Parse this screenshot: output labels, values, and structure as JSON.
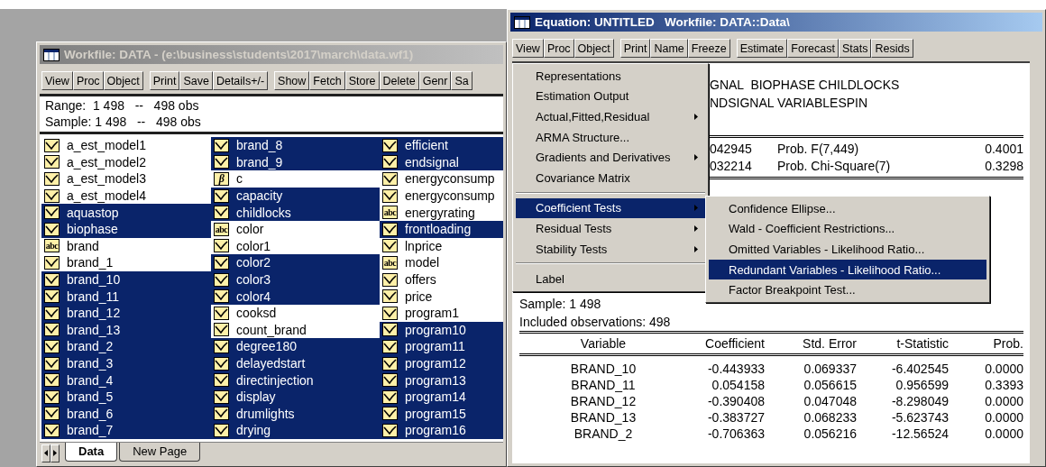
{
  "workfile": {
    "title": "Workfile: DATA - (e:\\business\\students\\2017\\march\\data.wf1)",
    "active": false,
    "toolbar": [
      [
        "View",
        "Proc",
        "Object"
      ],
      [
        "Print",
        "Save",
        "Details+/-"
      ],
      [
        "Show",
        "Fetch",
        "Store",
        "Delete",
        "Genr",
        "Sa"
      ]
    ],
    "range": "Range:  1 498   --   498 obs",
    "sample": "Sample: 1 498   --   498 obs",
    "objects": [
      {
        "name": "a_est_model1",
        "kind": "series",
        "selected": false
      },
      {
        "name": "a_est_model2",
        "kind": "series",
        "selected": false
      },
      {
        "name": "a_est_model3",
        "kind": "series",
        "selected": false
      },
      {
        "name": "a_est_model4",
        "kind": "series",
        "selected": false
      },
      {
        "name": "aquastop",
        "kind": "series",
        "selected": true
      },
      {
        "name": "biophase",
        "kind": "series",
        "selected": true
      },
      {
        "name": "brand",
        "kind": "alpha",
        "icon": "abc",
        "selected": false
      },
      {
        "name": "brand_1",
        "kind": "series",
        "selected": false
      },
      {
        "name": "brand_10",
        "kind": "series",
        "selected": true
      },
      {
        "name": "brand_11",
        "kind": "series",
        "selected": true
      },
      {
        "name": "brand_12",
        "kind": "series",
        "selected": true
      },
      {
        "name": "brand_13",
        "kind": "series",
        "selected": true
      },
      {
        "name": "brand_2",
        "kind": "series",
        "selected": true
      },
      {
        "name": "brand_3",
        "kind": "series",
        "selected": true
      },
      {
        "name": "brand_4",
        "kind": "series",
        "selected": true
      },
      {
        "name": "brand_5",
        "kind": "series",
        "selected": true
      },
      {
        "name": "brand_6",
        "kind": "series",
        "selected": true
      },
      {
        "name": "brand_7",
        "kind": "series",
        "selected": true
      },
      {
        "name": "brand_8",
        "kind": "series",
        "selected": true
      },
      {
        "name": "brand_9",
        "kind": "series",
        "selected": true
      },
      {
        "name": "c",
        "kind": "coef",
        "icon": "β",
        "selected": false
      },
      {
        "name": "capacity",
        "kind": "series",
        "selected": true
      },
      {
        "name": "childlocks",
        "kind": "series",
        "selected": true
      },
      {
        "name": "color",
        "kind": "alpha",
        "icon": "abc",
        "selected": false
      },
      {
        "name": "color1",
        "kind": "series",
        "selected": false
      },
      {
        "name": "color2",
        "kind": "series",
        "selected": true
      },
      {
        "name": "color3",
        "kind": "series",
        "selected": true
      },
      {
        "name": "color4",
        "kind": "series",
        "selected": true
      },
      {
        "name": "cooksd",
        "kind": "series",
        "selected": false
      },
      {
        "name": "count_brand",
        "kind": "series",
        "selected": false
      },
      {
        "name": "degree180",
        "kind": "series",
        "selected": true
      },
      {
        "name": "delayedstart",
        "kind": "series",
        "selected": true
      },
      {
        "name": "directinjection",
        "kind": "series",
        "selected": true
      },
      {
        "name": "display",
        "kind": "series",
        "selected": true
      },
      {
        "name": "drumlights",
        "kind": "series",
        "selected": true
      },
      {
        "name": "drying",
        "kind": "series",
        "selected": true
      },
      {
        "name": "efficient",
        "kind": "series",
        "selected": true
      },
      {
        "name": "endsignal",
        "kind": "series",
        "selected": true
      },
      {
        "name": "energyconsump",
        "kind": "series",
        "selected": false
      },
      {
        "name": "energyconsump",
        "kind": "series",
        "selected": false
      },
      {
        "name": "energyrating",
        "kind": "alpha",
        "icon": "abc",
        "selected": false
      },
      {
        "name": "frontloading",
        "kind": "series",
        "selected": true
      },
      {
        "name": "lnprice",
        "kind": "series",
        "selected": false
      },
      {
        "name": "model",
        "kind": "alpha",
        "icon": "abc",
        "selected": false
      },
      {
        "name": "offers",
        "kind": "series",
        "selected": false
      },
      {
        "name": "price",
        "kind": "series",
        "selected": false
      },
      {
        "name": "program1",
        "kind": "series",
        "selected": false
      },
      {
        "name": "program10",
        "kind": "series",
        "selected": true
      },
      {
        "name": "program11",
        "kind": "series",
        "selected": true
      },
      {
        "name": "program12",
        "kind": "series",
        "selected": true
      },
      {
        "name": "program13",
        "kind": "series",
        "selected": true
      },
      {
        "name": "program14",
        "kind": "series",
        "selected": true
      },
      {
        "name": "program15",
        "kind": "series",
        "selected": true
      },
      {
        "name": "program16",
        "kind": "series",
        "selected": true
      }
    ],
    "tabs": [
      {
        "label": "Data",
        "selected": true
      },
      {
        "label": "New Page",
        "selected": false
      }
    ]
  },
  "equation": {
    "title": "Equation: UNTITLED   Workfile: DATA::Data\\",
    "active": true,
    "toolbar": [
      [
        "View",
        "Proc",
        "Object"
      ],
      [
        "Print",
        "Name",
        "Freeze"
      ],
      [
        "Estimate",
        "Forecast",
        "Stats",
        "Resids"
      ]
    ],
    "output": {
      "lines": [
        "GNAL  BIOPHASE CHILDLOCKS",
        "NDSIGNAL VARIABLESPIN"
      ],
      "stats": [
        {
          "value": "042945",
          "label": "Prob. F(7,449)",
          "prob": "0.4001"
        },
        {
          "value": "032214",
          "label": "Prob. Chi-Square(7)",
          "prob": "0.3298"
        }
      ],
      "sample": "Sample: 1 498",
      "observations": "Included observations: 498",
      "columns": [
        "Variable",
        "Coefficient",
        "Std. Error",
        "t-Statistic",
        "Prob."
      ],
      "rows": [
        [
          "BRAND_10",
          "-0.443933",
          "0.069337",
          "-6.402545",
          "0.0000"
        ],
        [
          "BRAND_11",
          "0.054158",
          "0.056615",
          "0.956599",
          "0.3393"
        ],
        [
          "BRAND_12",
          "-0.390408",
          "0.047048",
          "-8.298049",
          "0.0000"
        ],
        [
          "BRAND_13",
          "-0.383727",
          "0.068233",
          "-5.623743",
          "0.0000"
        ],
        [
          "BRAND_2",
          "-0.706363",
          "0.056216",
          "-12.56524",
          "0.0000"
        ]
      ]
    },
    "menu": {
      "items": [
        {
          "kind": "item",
          "label": "Representations",
          "submenu": false,
          "selected": false
        },
        {
          "kind": "item",
          "label": "Estimation Output",
          "submenu": false,
          "selected": false
        },
        {
          "kind": "item",
          "label": "Actual,Fitted,Residual",
          "submenu": true,
          "selected": false
        },
        {
          "kind": "item",
          "label": "ARMA Structure...",
          "submenu": false,
          "selected": false
        },
        {
          "kind": "item",
          "label": "Gradients and Derivatives",
          "submenu": true,
          "selected": false
        },
        {
          "kind": "item",
          "label": "Covariance Matrix",
          "submenu": false,
          "selected": false
        },
        {
          "kind": "separator"
        },
        {
          "kind": "item",
          "label": "Coefficient Tests",
          "submenu": true,
          "selected": true
        },
        {
          "kind": "item",
          "label": "Residual Tests",
          "submenu": true,
          "selected": false
        },
        {
          "kind": "item",
          "label": "Stability Tests",
          "submenu": true,
          "selected": false
        },
        {
          "kind": "separator"
        },
        {
          "kind": "item",
          "label": "Label",
          "submenu": false,
          "selected": false
        }
      ]
    },
    "submenu": {
      "items": [
        {
          "label": "Confidence Ellipse...",
          "selected": false
        },
        {
          "label": "Wald - Coefficient Restrictions...",
          "selected": false
        },
        {
          "label": "Omitted Variables - Likelihood Ratio...",
          "selected": false
        },
        {
          "label": "Redundant Variables - Likelihood Ratio...",
          "selected": true
        },
        {
          "label": "Factor Breakpoint Test...",
          "selected": false
        }
      ]
    }
  }
}
